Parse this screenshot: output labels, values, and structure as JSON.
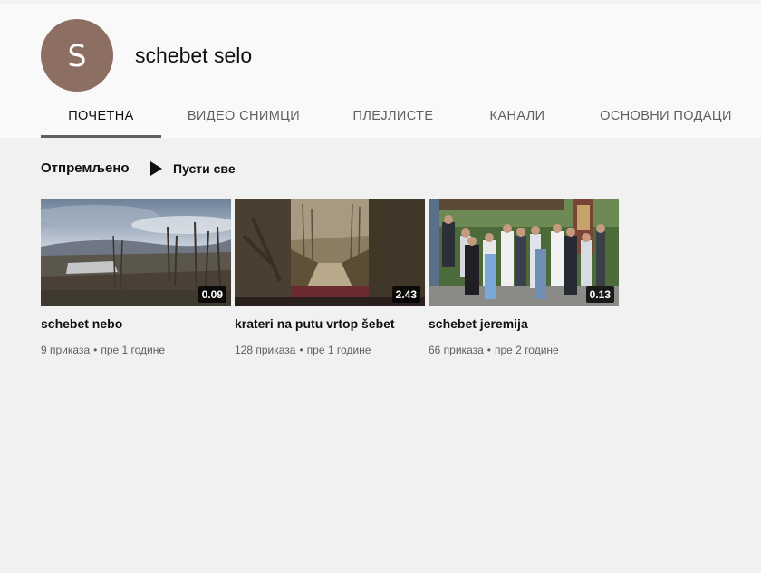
{
  "channel": {
    "avatar_letter": "S",
    "avatar_color": "#8d6e63",
    "name": "schebet selo"
  },
  "tabs": [
    {
      "label": "ПОЧЕТНА",
      "active": true
    },
    {
      "label": "ВИДЕО СНИМЦИ",
      "active": false
    },
    {
      "label": "ПЛЕЈЛИСТЕ",
      "active": false
    },
    {
      "label": "КАНАЛИ",
      "active": false
    },
    {
      "label": "ОСНОВНИ ПОДАЦИ",
      "active": false
    }
  ],
  "shelf": {
    "title": "Отпремљено",
    "play_all_label": "Пусти све",
    "play_icon": "play-icon"
  },
  "videos": [
    {
      "title": "schebet nebo",
      "duration": "0.09",
      "views": "9 приказа",
      "age": "пре 1 године"
    },
    {
      "title": "krateri na putu vrtop šebet",
      "duration": "2.43",
      "views": "128 приказа",
      "age": "пре 1 године"
    },
    {
      "title": "schebet jeremija",
      "duration": "0.13",
      "views": "66 приказа",
      "age": "пре 2 године"
    }
  ],
  "meta_separator": "•"
}
